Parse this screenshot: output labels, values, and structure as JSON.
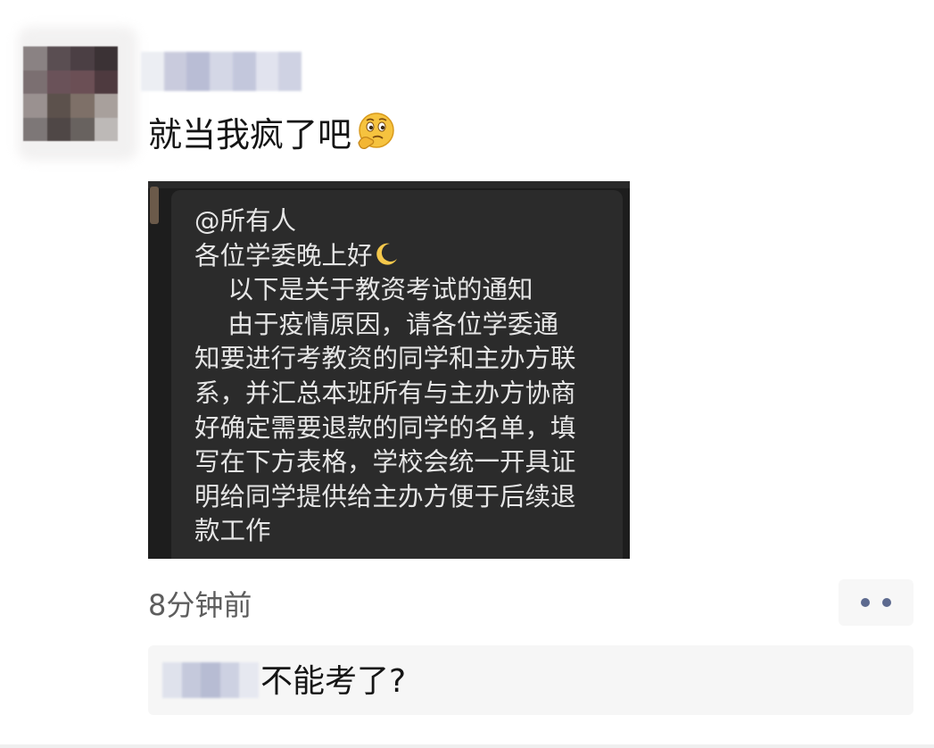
{
  "post": {
    "text": "就当我疯了吧",
    "emoji": "thinking-face-emoji",
    "time": "8分钟前",
    "author_name": "",
    "attached_image": {
      "lines": [
        "@所有人",
        "各位学委晚上好",
        "　 以下是关于教资考试的通知",
        "　 由于疫情原因，请各位学委通",
        "知要进行考教资的同学和主办方联",
        "系，并汇总本班所有与主办方协商",
        "好确定需要退款的同学的名单，填",
        "写在下方表格，学校会统一开具证",
        "明给同学提供给主办方便于后续退",
        "款工作"
      ],
      "moon_emoji": "crescent-moon-emoji"
    }
  },
  "comment": {
    "author_name": "",
    "text": "不能考了?"
  },
  "colors": {
    "link_blue": "#5d6a8f",
    "dark_bubble": "#2b2b2b",
    "screenshot_bg": "#1d1d1d"
  }
}
